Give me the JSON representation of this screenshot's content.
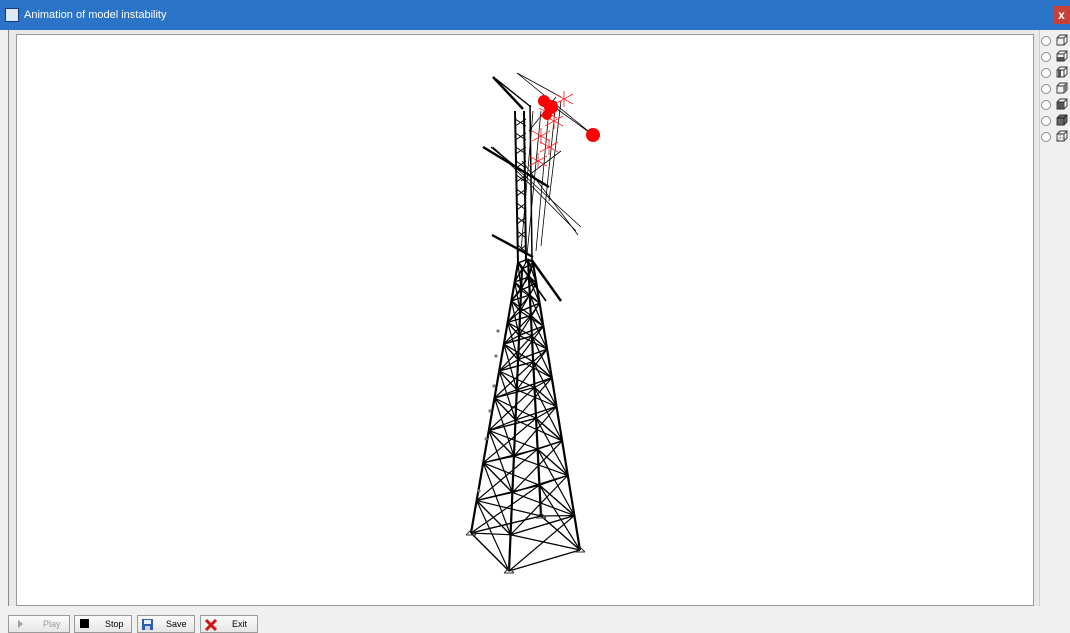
{
  "window": {
    "title": "Animation of model instability",
    "close_label": "x"
  },
  "toolbar": {
    "play_label": "Play",
    "stop_label": "Stop",
    "save_label": "Save",
    "exit_label": "Exit",
    "play_enabled": false
  },
  "view_options": [
    {
      "icon": "cube-view-1-icon",
      "selected": false
    },
    {
      "icon": "cube-view-2-icon",
      "selected": false
    },
    {
      "icon": "cube-view-3-icon",
      "selected": false
    },
    {
      "icon": "cube-view-4-icon",
      "selected": false
    },
    {
      "icon": "cube-view-5-icon",
      "selected": false
    },
    {
      "icon": "cube-view-6-icon",
      "selected": false
    },
    {
      "icon": "cube-view-7-icon",
      "selected": false
    }
  ],
  "colors": {
    "titlebar": "#2b73c7",
    "close": "#c7413a",
    "structure": "#000000",
    "instability_marker": "#ff0000"
  }
}
